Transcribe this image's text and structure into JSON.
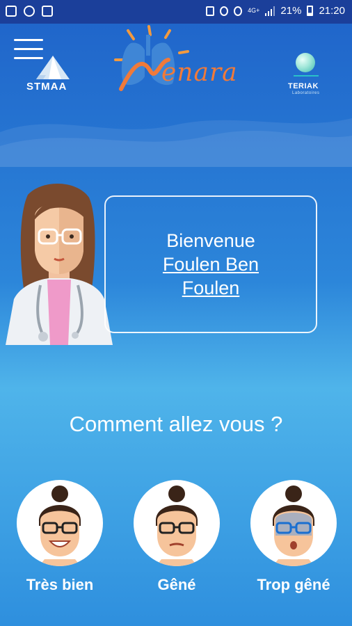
{
  "status_bar": {
    "battery": "21%",
    "time": "21:20",
    "network": "4G+"
  },
  "header": {
    "menu_icon": "hamburger-icon",
    "left_logo": "STMAA",
    "app_logo": "enara",
    "right_logo": "TERIAK",
    "right_logo_sub": "Laboratoires"
  },
  "welcome": {
    "greeting": "Bienvenue",
    "user_name": "Foulen Ben Foulen"
  },
  "question": "Comment allez vous ?",
  "moods": [
    {
      "label": "Très bien",
      "face": "happy"
    },
    {
      "label": "Gêné",
      "face": "neutral"
    },
    {
      "label": "Trop gêné",
      "face": "sick"
    }
  ],
  "colors": {
    "status_bar": "#1b3f9a",
    "accent_orange": "#f07a3a",
    "background_top": "#1f63c9",
    "background_mid": "#4fb4ea"
  }
}
